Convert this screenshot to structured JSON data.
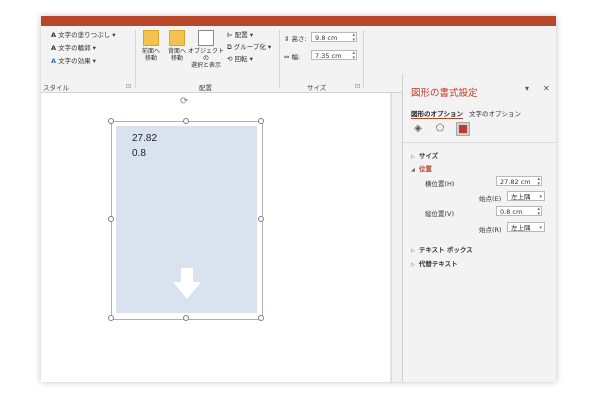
{
  "ribbon": {
    "style_group": {
      "label": "スタイル",
      "items": [
        "文字の塗りつぶし",
        "文字の輪郭",
        "文字の効果"
      ]
    },
    "arrange_group": {
      "label": "配置",
      "bring_forward": [
        "前面へ",
        "移動"
      ],
      "send_backward": [
        "背面へ",
        "移動"
      ],
      "selection_pane": [
        "オブジェクトの",
        "選択と表示"
      ],
      "align": "配置",
      "group": "グループ化",
      "rotate": "回転"
    },
    "size_group": {
      "label": "サイズ",
      "height_label": "高さ:",
      "height_value": "9.8 cm",
      "width_label": "幅:",
      "width_value": "7.35 cm"
    }
  },
  "shape": {
    "line1": "27.82",
    "line2": "0.8"
  },
  "pane": {
    "title": "図形の書式設定",
    "tabs": [
      "図形のオプション",
      "文字のオプション"
    ],
    "sections": {
      "size": "サイズ",
      "position": "位置",
      "textbox": "テキスト ボックス",
      "alttext": "代替テキスト"
    },
    "position": {
      "h_label": "横位置(H)",
      "h_value": "27.82 cm",
      "h_from_label": "始点(E)",
      "h_from_value": "左上隅",
      "v_label": "縦位置(V)",
      "v_value": "0.8 cm",
      "v_from_label": "始点(R)",
      "v_from_value": "左上隅"
    }
  },
  "colors": {
    "accent": "#b7472a",
    "shape_fill": "#d9e3f0",
    "pane_title": "#c0392b"
  }
}
